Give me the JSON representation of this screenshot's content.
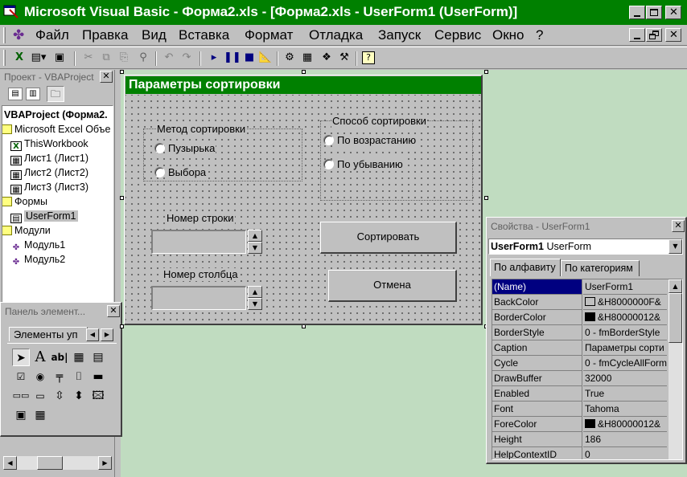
{
  "title_bar": {
    "title": "Microsoft Visual Basic - Форма2.xls - [Форма2.xls - UserForm1 (UserForm)]",
    "icon": "vb-app-icon",
    "color": "#008000"
  },
  "menu": {
    "items": [
      "Файл",
      "Правка",
      "Вид",
      "Вставка",
      "Формат",
      "Отладка",
      "Запуск",
      "Сервис",
      "Окно",
      "?"
    ]
  },
  "toolbar": {
    "icons": [
      "excel-icon",
      "insert-userform-icon",
      "save-icon",
      "cut-icon",
      "copy-icon",
      "paste-icon",
      "find-icon",
      "undo-icon",
      "redo-icon",
      "run-icon",
      "break-icon",
      "reset-icon",
      "design-mode-icon",
      "project-explorer-icon",
      "properties-icon",
      "object-browser-icon",
      "toolbox-icon",
      "help-icon"
    ]
  },
  "project_panel": {
    "title": "Проект - VBAProject",
    "root": "VBAProject (Форма2.",
    "items": [
      {
        "label": "Microsoft Excel Объе",
        "icon": "folder-icon"
      },
      {
        "label": "ThisWorkbook",
        "icon": "workbook-icon"
      },
      {
        "label": "Лист1 (Лист1)",
        "icon": "sheet-icon"
      },
      {
        "label": "Лист2 (Лист2)",
        "icon": "sheet-icon"
      },
      {
        "label": "Лист3 (Лист3)",
        "icon": "sheet-icon"
      },
      {
        "label": "Формы",
        "icon": "folder-icon"
      },
      {
        "label": "UserForm1",
        "icon": "form-icon"
      },
      {
        "label": "Модули",
        "icon": "folder-icon"
      },
      {
        "label": "Модуль1",
        "icon": "module-icon"
      },
      {
        "label": "Модуль2",
        "icon": "module-icon"
      }
    ]
  },
  "toolbox": {
    "title": "Панель элемент...",
    "tab_label": "Элементы уп",
    "tools": [
      "pointer-icon",
      "label-tool-icon",
      "textbox-tool-icon",
      "combobox-tool-icon",
      "listbox-tool-icon",
      "checkbox-tool-icon",
      "optionbutton-tool-icon",
      "togglebutton-tool-icon",
      "frame-tool-icon",
      "commandbutton-tool-icon",
      "tabstrip-tool-icon",
      "multipage-tool-icon",
      "scrollbar-tool-icon",
      "spinbutton-tool-icon",
      "image-tool-icon",
      "refedit-tool-icon",
      "calendar-tool-icon"
    ]
  },
  "userform": {
    "caption": "Параметры сортировки",
    "caption_color": "#008000",
    "frame1": {
      "label": "Метод сортировки",
      "options": [
        "Пузырька",
        "Выбора"
      ]
    },
    "frame2": {
      "label": "Способ сортировки",
      "options": [
        "По возрастанию",
        "По убыванию"
      ]
    },
    "row_label": "Номер строки",
    "col_label": "Номер столбца",
    "sort_button": "Сортировать",
    "cancel_button": "Отмена"
  },
  "properties": {
    "title": "Свойства - UserForm1",
    "object_name": "UserForm1",
    "object_type": "UserForm",
    "tabs": [
      "По алфавиту",
      "По категориям"
    ],
    "rows": [
      {
        "name": "(Name)",
        "value": "UserForm1"
      },
      {
        "name": "BackColor",
        "value": "&H8000000F&",
        "swatch": "#c0c0c0"
      },
      {
        "name": "BorderColor",
        "value": "&H80000012&",
        "swatch": "#000000"
      },
      {
        "name": "BorderStyle",
        "value": "0 - fmBorderStyle"
      },
      {
        "name": "Caption",
        "value": "Параметры сорти"
      },
      {
        "name": "Cycle",
        "value": "0 - fmCycleAllForm"
      },
      {
        "name": "DrawBuffer",
        "value": "32000"
      },
      {
        "name": "Enabled",
        "value": "True"
      },
      {
        "name": "Font",
        "value": "Tahoma"
      },
      {
        "name": "ForeColor",
        "value": "&H80000012&",
        "swatch": "#000000"
      },
      {
        "name": "Height",
        "value": "186"
      },
      {
        "name": "HelpContextID",
        "value": "0"
      }
    ]
  },
  "workspace_color": "#c0dcc0"
}
